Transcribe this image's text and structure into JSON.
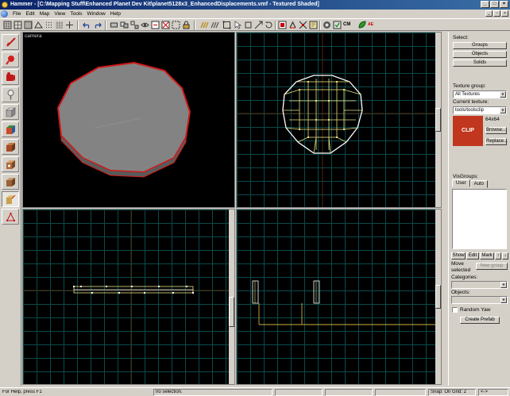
{
  "window": {
    "title": "Hammer - [C:\\Mapping Stuff\\Enhanced Planet Dev Kit\\planet5128x3_EnhancedDisplacements.vmf - Textured Shaded]",
    "controls": [
      "_",
      "□",
      "×"
    ]
  },
  "menu": {
    "items": [
      "File",
      "Edit",
      "Map",
      "View",
      "Tools",
      "Window",
      "Help"
    ]
  },
  "toolbar": {
    "buttons": [
      "new-file-icon",
      "open-file-icon",
      "save-icon",
      "grid-toggle-icon",
      "grid-smaller-icon",
      "grid-larger-icon",
      "undo-icon",
      "redo-icon",
      "carve-icon",
      "group-icon",
      "ungroup-icon",
      "hide-icon",
      "show-icon",
      "hide-selected-icon",
      "cordon-icon",
      "texture-lock-icon",
      "snap-icon",
      "bounding-box-icon",
      "compile-icon",
      "run-map-icon",
      "entity-report-icon",
      "check-problems-icon",
      "map-properties-icon",
      "toggle-select-icon"
    ],
    "cm_label": "CM",
    "ae_label": "AE"
  },
  "left_tools": [
    "selection-tool-icon",
    "magnify-tool-icon",
    "camera-tool-icon",
    "entity-tool-icon",
    "block-tool-icon",
    "texture-application-icon",
    "apply-current-texture-icon",
    "decal-tool-icon",
    "overlay-tool-icon",
    "clipping-tool-icon",
    "vertex-tool-icon"
  ],
  "viewports": {
    "camera": {
      "label": "camera"
    },
    "top": {
      "label": ""
    },
    "front": {
      "label": ""
    },
    "side": {
      "label": ""
    }
  },
  "right_panel": {
    "select_label": "Select:",
    "groups_btn": "Groups",
    "objects_btn": "Objects",
    "solids_btn": "Solids",
    "texture_group_label": "Texture group:",
    "texture_group_value": "All Textures",
    "current_texture_label": "Current texture:",
    "current_texture_value": "tools/toolsclip",
    "texture_size": "64x64",
    "texture_preview_text": "CLIP",
    "browse_btn": "Browse...",
    "replace_btn": "Replace...",
    "visgroups_label": "VisGroups:",
    "tab_user": "User",
    "tab_auto": "Auto",
    "show_btn": "Show",
    "edit_btn": "Edit",
    "mark_btn": "Mark",
    "up_btn": "↑",
    "down_btn": "↓",
    "move_selected_label": "Move selected",
    "new_group_btn": "New group",
    "categories_label": "Categories:",
    "objects_label": "Objects:",
    "random_yaw_label": "Random Yaw",
    "create_prefab_btn": "Create Prefab"
  },
  "status": {
    "help": "For Help, press F1",
    "selection": "no selection.",
    "snap": "Snap: On Grid: 2",
    "coords": "<->"
  },
  "colors": {
    "title_start": "#0a246a",
    "title_end": "#3a6ea5",
    "clip_texture": "#c0361e",
    "wire_yellow": "#e8e080",
    "wire_white": "#ffffff",
    "grid_cyan": "#0a4a4a",
    "grid_brown": "#4a2a10"
  }
}
